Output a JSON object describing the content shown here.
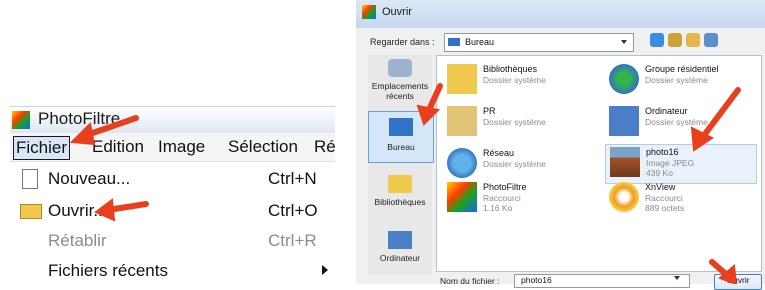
{
  "photofiltre": {
    "title": "PhotoFiltre",
    "menubar": [
      "Fichier",
      "Edition",
      "Image",
      "Sélection",
      "Ré"
    ],
    "menu_items": [
      {
        "label": "Nouveau...",
        "shortcut": "Ctrl+N",
        "icon": "new-document-icon",
        "enabled": true
      },
      {
        "label": "Ouvrir...",
        "shortcut": "Ctrl+O",
        "icon": "open-folder-icon",
        "enabled": true
      },
      {
        "label": "Rétablir",
        "shortcut": "Ctrl+R",
        "icon": "",
        "enabled": false
      },
      {
        "label": "Fichiers récents",
        "shortcut": "",
        "icon": "submenu-arrow-icon",
        "enabled": true
      }
    ]
  },
  "dialog": {
    "title": "Ouvrir",
    "look_in_label": "Regarder dans :",
    "look_in_value": "Bureau",
    "places": [
      {
        "label": "Emplacements récents",
        "icon": "recent-places-icon"
      },
      {
        "label": "Bureau",
        "icon": "desktop-icon",
        "selected": true
      },
      {
        "label": "Bibliothèques",
        "icon": "libraries-icon"
      },
      {
        "label": "Ordinateur",
        "icon": "computer-icon"
      }
    ],
    "files": [
      {
        "name": "Bibliothèques",
        "sub1": "Dossier système",
        "sub2": "",
        "icon": "libraries-folder-icon"
      },
      {
        "name": "Groupe résidentiel",
        "sub1": "Dossier système",
        "sub2": "",
        "icon": "homegroup-icon"
      },
      {
        "name": "PR",
        "sub1": "Dossier système",
        "sub2": "",
        "icon": "user-folder-icon"
      },
      {
        "name": "Ordinateur",
        "sub1": "Dossier système",
        "sub2": "",
        "icon": "computer-icon"
      },
      {
        "name": "Réseau",
        "sub1": "Dossier système",
        "sub2": "",
        "icon": "network-icon"
      },
      {
        "name": "photo16",
        "sub1": "Image JPEG",
        "sub2": "439 Ko",
        "icon": "image-thumbnail-icon"
      },
      {
        "name": "PhotoFiltre",
        "sub1": "Raccourci",
        "sub2": "1.16 Ko",
        "icon": "photofiltre-shortcut-icon"
      },
      {
        "name": "XnView",
        "sub1": "Raccourci",
        "sub2": "889 octets",
        "icon": "xnview-shortcut-icon"
      }
    ],
    "filename_label": "Nom du fichier :",
    "filename_value": "photo16",
    "open_button": "Ouvrir"
  },
  "colors": {
    "accent": "#e8401c",
    "selection": "#d5e6f8",
    "titlebar": "#c6d8ef"
  }
}
